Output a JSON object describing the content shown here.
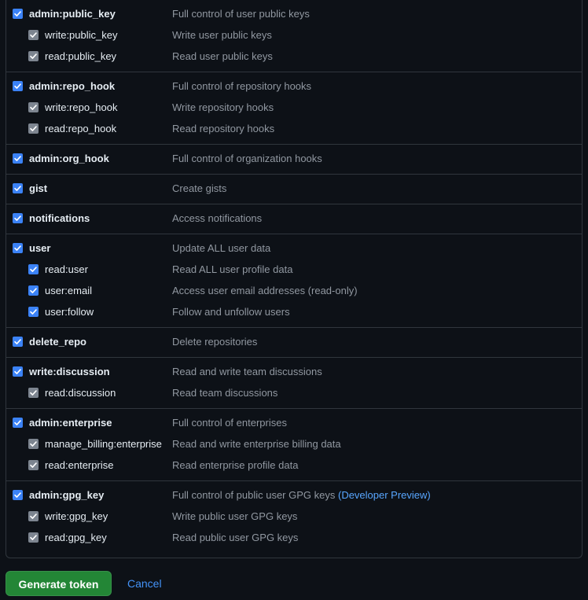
{
  "scope_groups": [
    {
      "key": "admin-public-key",
      "parent": {
        "name": "admin:public_key",
        "description": "Full control of user public keys",
        "checked": true
      },
      "children": [
        {
          "name": "write:public_key",
          "description": "Write user public keys",
          "checked": true,
          "disabled": true
        },
        {
          "name": "read:public_key",
          "description": "Read user public keys",
          "checked": true,
          "disabled": true
        }
      ]
    },
    {
      "key": "admin-repo-hook",
      "parent": {
        "name": "admin:repo_hook",
        "description": "Full control of repository hooks",
        "checked": true
      },
      "children": [
        {
          "name": "write:repo_hook",
          "description": "Write repository hooks",
          "checked": true,
          "disabled": true
        },
        {
          "name": "read:repo_hook",
          "description": "Read repository hooks",
          "checked": true,
          "disabled": true
        }
      ]
    },
    {
      "key": "admin-org-hook",
      "parent": {
        "name": "admin:org_hook",
        "description": "Full control of organization hooks",
        "checked": true
      },
      "children": []
    },
    {
      "key": "gist",
      "parent": {
        "name": "gist",
        "description": "Create gists",
        "checked": true
      },
      "children": []
    },
    {
      "key": "notifications",
      "parent": {
        "name": "notifications",
        "description": "Access notifications",
        "checked": true
      },
      "children": []
    },
    {
      "key": "user",
      "parent": {
        "name": "user",
        "description": "Update ALL user data",
        "checked": true
      },
      "children": [
        {
          "name": "read:user",
          "description": "Read ALL user profile data",
          "checked": true,
          "disabled": false
        },
        {
          "name": "user:email",
          "description": "Access user email addresses (read-only)",
          "checked": true,
          "disabled": false
        },
        {
          "name": "user:follow",
          "description": "Follow and unfollow users",
          "checked": true,
          "disabled": false
        }
      ]
    },
    {
      "key": "delete-repo",
      "parent": {
        "name": "delete_repo",
        "description": "Delete repositories",
        "checked": true
      },
      "children": []
    },
    {
      "key": "write-discussion",
      "parent": {
        "name": "write:discussion",
        "description": "Read and write team discussions",
        "checked": true
      },
      "children": [
        {
          "name": "read:discussion",
          "description": "Read team discussions",
          "checked": true,
          "disabled": true
        }
      ]
    },
    {
      "key": "admin-enterprise",
      "parent": {
        "name": "admin:enterprise",
        "description": "Full control of enterprises",
        "checked": true
      },
      "children": [
        {
          "name": "manage_billing:enterprise",
          "description": "Read and write enterprise billing data",
          "checked": true,
          "disabled": true
        },
        {
          "name": "read:enterprise",
          "description": "Read enterprise profile data",
          "checked": true,
          "disabled": true
        }
      ]
    },
    {
      "key": "admin-gpg-key",
      "parent": {
        "name": "admin:gpg_key",
        "description": "Full control of public user GPG keys",
        "preview_label": "(Developer Preview)",
        "checked": true
      },
      "children": [
        {
          "name": "write:gpg_key",
          "description": "Write public user GPG keys",
          "checked": true,
          "disabled": true
        },
        {
          "name": "read:gpg_key",
          "description": "Read public user GPG keys",
          "checked": true,
          "disabled": true
        }
      ]
    }
  ],
  "actions": {
    "generate_label": "Generate token",
    "cancel_label": "Cancel"
  },
  "colors": {
    "background": "#0d1117",
    "border": "#30363d",
    "checkbox_active": "#3b82f6",
    "checkbox_disabled": "#7d8590",
    "primary_button": "#238636",
    "link": "#4493f8"
  },
  "icons": {
    "checkbox": "check-icon"
  }
}
